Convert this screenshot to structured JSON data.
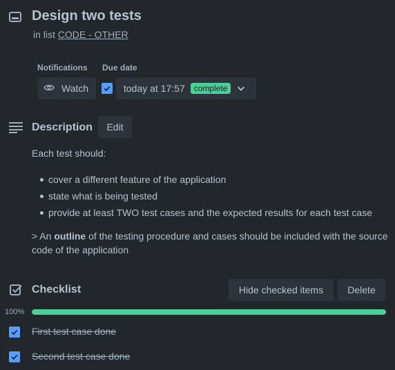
{
  "card": {
    "icon": "card-icon",
    "title": "Design two tests",
    "in_list_prefix": "in list",
    "list_name": "CODE - OTHER"
  },
  "notifications": {
    "label": "Notifications",
    "watch_label": "Watch",
    "icon": "eye-icon"
  },
  "due_date": {
    "label": "Due date",
    "checked": true,
    "value": "today at 17:57",
    "badge": "complete",
    "badge_color": "#4bce97"
  },
  "description": {
    "icon": "description-icon",
    "heading": "Description",
    "edit_label": "Edit",
    "intro": "Each test should:",
    "bullets": [
      "cover a different feature of the application",
      "state what is being tested",
      "provide at least TWO test cases and the expected results for each test case"
    ],
    "quote_prefix": "> An ",
    "quote_bold": "outline",
    "quote_rest": " of the testing procedure and cases should be included with the source code of the application"
  },
  "checklist": {
    "icon": "checklist-icon",
    "heading": "Checklist",
    "hide_label": "Hide checked items",
    "delete_label": "Delete",
    "progress_text": "100%",
    "progress_fraction": 1.0,
    "progress_color": "#4bce97",
    "items": [
      {
        "text": "First test case done",
        "checked": true
      },
      {
        "text": "Second test case done",
        "checked": true
      }
    ]
  },
  "colors": {
    "background": "#22272b",
    "button": "#2c333a",
    "accent": "#579dff"
  }
}
